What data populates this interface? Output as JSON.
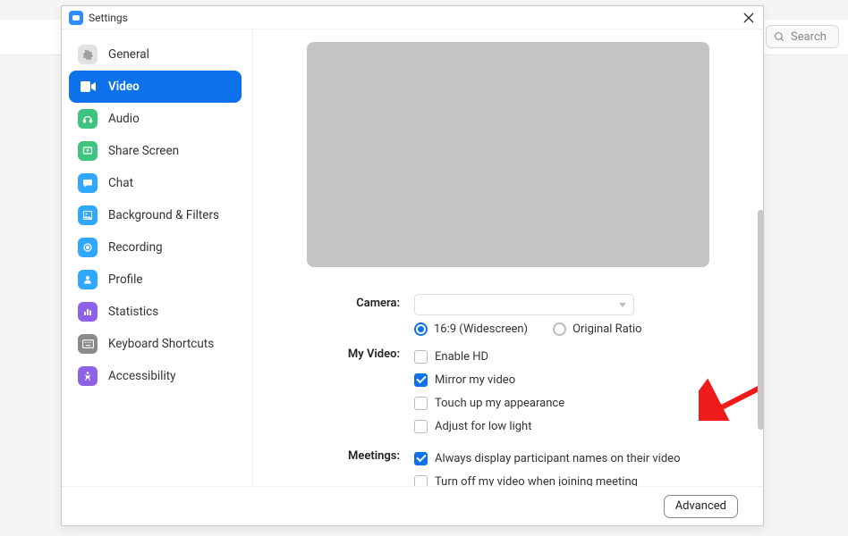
{
  "topbar": {
    "search_placeholder": "Search"
  },
  "window": {
    "title": "Settings"
  },
  "sidebar": {
    "items": [
      {
        "label": "General",
        "icon": "gear-icon",
        "color": "#e2e2e2",
        "glyph": "#9f9f9f"
      },
      {
        "label": "Video",
        "icon": "video-icon",
        "color": "#ffffff",
        "glyph": "#ffffff"
      },
      {
        "label": "Audio",
        "icon": "audio-icon",
        "color": "#3DC47E",
        "glyph": "#ffffff"
      },
      {
        "label": "Share Screen",
        "icon": "share-icon",
        "color": "#3DC47E",
        "glyph": "#ffffff"
      },
      {
        "label": "Chat",
        "icon": "chat-icon",
        "color": "#31A8FF",
        "glyph": "#ffffff"
      },
      {
        "label": "Background & Filters",
        "icon": "bg-icon",
        "color": "#31A8FF",
        "glyph": "#ffffff"
      },
      {
        "label": "Recording",
        "icon": "record-icon",
        "color": "#31A8FF",
        "glyph": "#ffffff"
      },
      {
        "label": "Profile",
        "icon": "profile-icon",
        "color": "#31A8FF",
        "glyph": "#ffffff"
      },
      {
        "label": "Statistics",
        "icon": "stats-icon",
        "color": "#8E62E8",
        "glyph": "#ffffff"
      },
      {
        "label": "Keyboard Shortcuts",
        "icon": "keyboard-icon",
        "color": "#8a8a8a",
        "glyph": "#ffffff"
      },
      {
        "label": "Accessibility",
        "icon": "a11y-icon",
        "color": "#8E62E8",
        "glyph": "#ffffff"
      }
    ],
    "active_index": 1
  },
  "content": {
    "camera_label": "Camera:",
    "ratio": {
      "wide": "16:9 (Widescreen)",
      "orig": "Original Ratio",
      "selected": "wide"
    },
    "myvideo_label": "My Video:",
    "myvideo": {
      "enable_hd": {
        "label": "Enable HD",
        "checked": false
      },
      "mirror": {
        "label": "Mirror my video",
        "checked": true
      },
      "touchup": {
        "label": "Touch up my appearance",
        "checked": false
      },
      "lowlight": {
        "label": "Adjust for low light",
        "checked": false
      }
    },
    "meetings_label": "Meetings:",
    "meetings": {
      "display_names": {
        "label": "Always display participant names on their video",
        "checked": true
      },
      "turn_off": {
        "label": "Turn off my video when joining meeting",
        "checked": false
      }
    }
  },
  "footer": {
    "advanced": "Advanced"
  }
}
